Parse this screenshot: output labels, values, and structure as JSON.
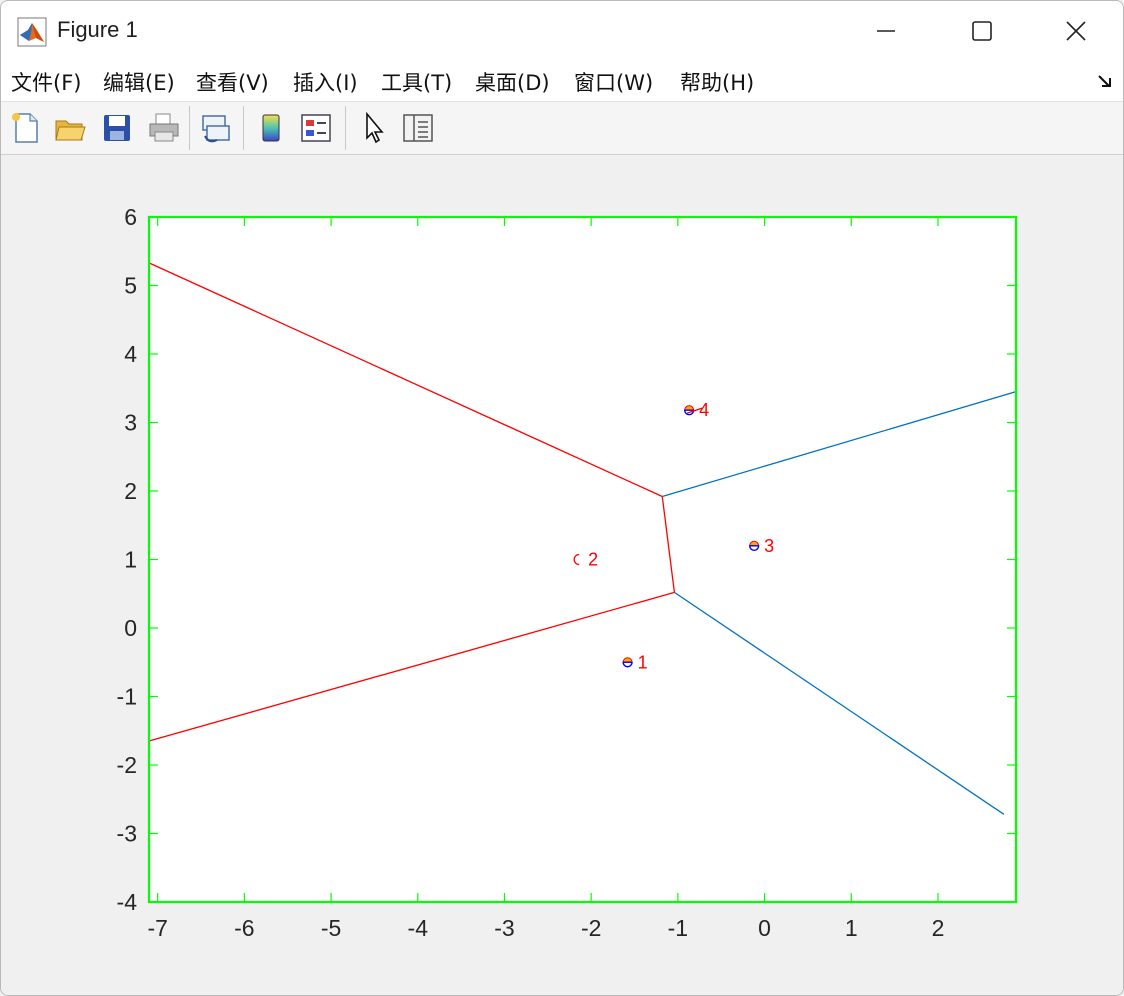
{
  "window": {
    "title": "Figure 1",
    "icons": {
      "app": "matlab-logo-icon",
      "minimize": "minimize-icon",
      "maximize": "maximize-icon",
      "close": "close-icon"
    }
  },
  "menubar": {
    "items": [
      {
        "label": "文件(F)"
      },
      {
        "label": "编辑(E)"
      },
      {
        "label": "查看(V)"
      },
      {
        "label": "插入(I)"
      },
      {
        "label": "工具(T)"
      },
      {
        "label": "桌面(D)"
      },
      {
        "label": "窗口(W)"
      },
      {
        "label": "帮助(H)"
      }
    ],
    "dock_icon": "dock-arrow-icon"
  },
  "toolbar": {
    "buttons": [
      {
        "icon": "new-figure-icon"
      },
      {
        "icon": "open-file-icon"
      },
      {
        "icon": "save-icon"
      },
      {
        "icon": "print-icon"
      },
      {
        "icon": "link-plot-icon"
      },
      {
        "icon": "insert-colorbar-icon"
      },
      {
        "icon": "insert-legend-icon"
      },
      {
        "icon": "edit-plot-pointer-icon"
      },
      {
        "icon": "property-inspector-icon"
      }
    ]
  },
  "chart_data": {
    "type": "line",
    "title": "",
    "xlabel": "",
    "ylabel": "",
    "xlim": [
      -7.1,
      2.9
    ],
    "ylim": [
      -4,
      6
    ],
    "xticks": [
      "-7",
      "-6",
      "-5",
      "-4",
      "-3",
      "-2",
      "-1",
      "0",
      "1",
      "2"
    ],
    "yticks": [
      "6",
      "5",
      "4",
      "3",
      "2",
      "1",
      "0",
      "-1",
      "-2",
      "-3",
      "-4"
    ],
    "axes_color": "#00ff00",
    "grid": false,
    "series": [
      {
        "color": "#ff0000",
        "segments": [
          [
            [
              -7.1,
              5.33
            ],
            [
              -1.18,
              1.92
            ]
          ],
          [
            [
              -1.18,
              1.92
            ],
            [
              -1.04,
              0.52
            ]
          ],
          [
            [
              -1.04,
              0.52
            ],
            [
              -7.1,
              -1.65
            ]
          ]
        ]
      },
      {
        "color": "#0072bd",
        "segments": [
          [
            [
              -1.18,
              1.92
            ],
            [
              2.9,
              3.45
            ]
          ],
          [
            [
              -1.04,
              0.52
            ],
            [
              2.76,
              -2.72
            ]
          ]
        ]
      }
    ],
    "points": [
      {
        "label": "1",
        "x": -1.58,
        "y": -0.5
      },
      {
        "label": "2",
        "x": -2.15,
        "y": 1.0
      },
      {
        "label": "3",
        "x": -0.12,
        "y": 1.2
      },
      {
        "label": "4",
        "x": -0.87,
        "y": 3.18
      }
    ],
    "label_color": "#ff0000",
    "marker_colors": [
      "#0000ff",
      "#ff0000",
      "#ffa500"
    ]
  }
}
